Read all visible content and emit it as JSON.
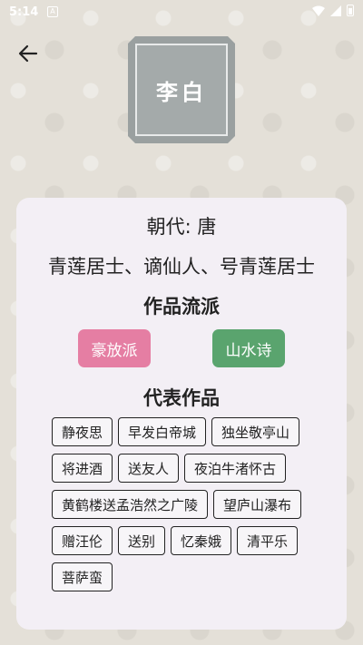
{
  "status_bar": {
    "time": "5:14",
    "notification_glyph": "A"
  },
  "poet": {
    "seal_name": "李白",
    "dynasty": "朝代: 唐",
    "alias": "青莲居士、谪仙人、号青莲居士"
  },
  "schools": {
    "title": "作品流派",
    "tags": [
      {
        "label": "豪放派",
        "color": "#e57ea3"
      },
      {
        "label": "山水诗",
        "color": "#5aa46e"
      }
    ]
  },
  "works": {
    "title": "代表作品",
    "items": [
      "静夜思",
      "早发白帝城",
      "独坐敬亭山",
      "将进酒",
      "送友人",
      "夜泊牛渚怀古",
      "黄鹤楼送孟浩然之广陵",
      "望庐山瀑布",
      "赠汪伦",
      "送别",
      "忆秦娥",
      "清平乐",
      "菩萨蛮"
    ]
  },
  "icons": [
    "back-arrow-icon",
    "wifi-icon",
    "signal-icon",
    "battery-icon"
  ]
}
